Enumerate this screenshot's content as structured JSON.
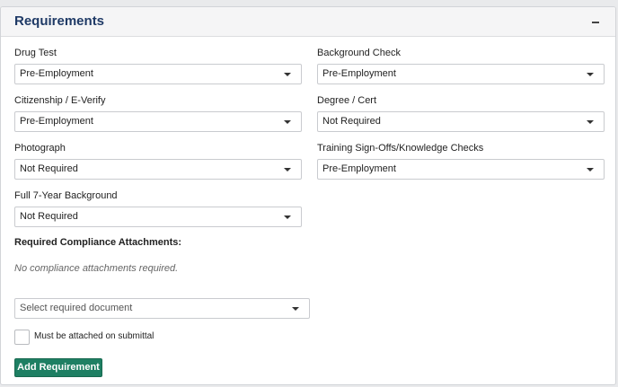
{
  "panel": {
    "title": "Requirements",
    "collapse_icon": "minus-icon"
  },
  "fields": {
    "drug_test": {
      "label": "Drug Test",
      "value": "Pre-Employment"
    },
    "background_check": {
      "label": "Background Check",
      "value": "Pre-Employment"
    },
    "citizenship": {
      "label": "Citizenship / E-Verify",
      "value": "Pre-Employment"
    },
    "degree": {
      "label": "Degree / Cert",
      "value": "Not Required"
    },
    "photograph": {
      "label": "Photograph",
      "value": "Not Required"
    },
    "training": {
      "label": "Training Sign-Offs/Knowledge Checks",
      "value": "Pre-Employment"
    },
    "full_background": {
      "label": "Full 7-Year Background",
      "value": "Not Required"
    }
  },
  "compliance": {
    "title": "Required Compliance Attachments:",
    "empty_message": "No compliance attachments required.",
    "document_select": {
      "placeholder": "Select required document"
    },
    "checkbox_label": "Must be attached on submittal",
    "checkbox_checked": false,
    "add_button_label": "Add Requirement"
  },
  "colors": {
    "title": "#1f3a66",
    "primary_button": "#1e7f63"
  }
}
